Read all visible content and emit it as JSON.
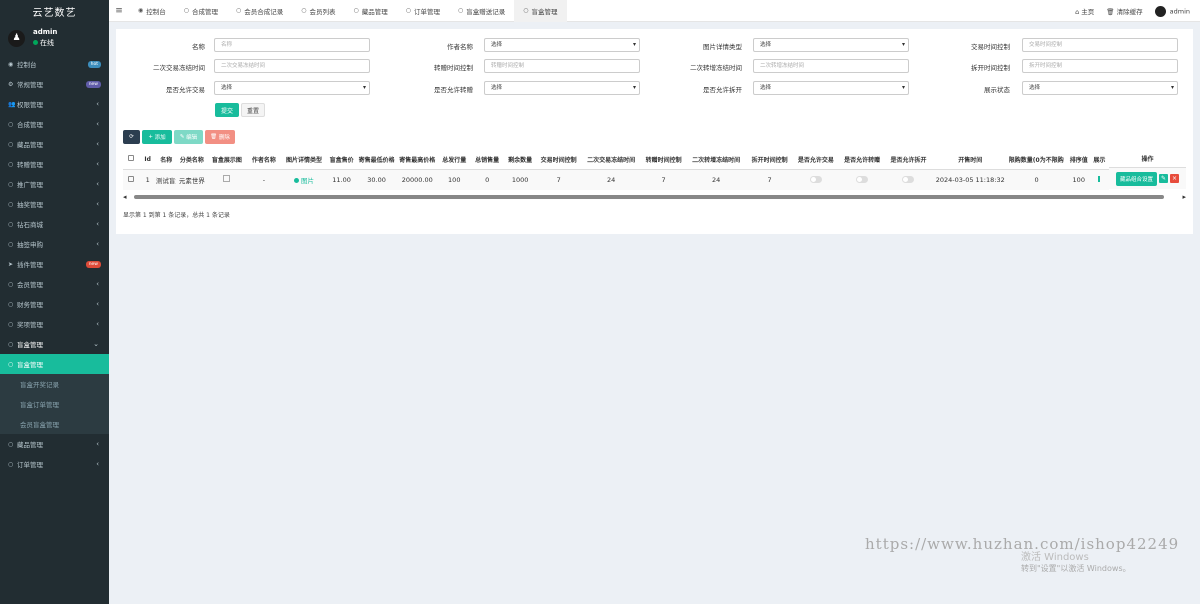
{
  "app": {
    "logo": "云艺数艺",
    "username": "admin",
    "status": "在线"
  },
  "menu": [
    {
      "label": "控制台",
      "icon": "dashboard-icon",
      "badge": "hot",
      "badge_color": "#3c8dbc"
    },
    {
      "label": "常规管理",
      "icon": "gear-icon",
      "badge": "new",
      "badge_color": "#605ca8"
    },
    {
      "label": "权限管理",
      "icon": "users-icon",
      "arrow": "‹"
    },
    {
      "label": "合成管理",
      "icon": "circle-icon",
      "arrow": "‹"
    },
    {
      "label": "藏品管理",
      "icon": "circle-icon",
      "arrow": "‹"
    },
    {
      "label": "转赠管理",
      "icon": "circle-icon",
      "arrow": "‹"
    },
    {
      "label": "推广管理",
      "icon": "circle-icon",
      "arrow": "‹"
    },
    {
      "label": "抽奖管理",
      "icon": "circle-icon",
      "arrow": "‹"
    },
    {
      "label": "钻石商城",
      "icon": "circle-icon",
      "arrow": "‹"
    },
    {
      "label": "抽签申购",
      "icon": "circle-icon",
      "arrow": "‹"
    },
    {
      "label": "插件管理",
      "icon": "rocket-icon",
      "badge": "new",
      "badge_color": "#dd4b39"
    },
    {
      "label": "会员管理",
      "icon": "circle-icon",
      "arrow": "‹"
    },
    {
      "label": "财务管理",
      "icon": "circle-icon",
      "arrow": "‹"
    },
    {
      "label": "奖项管理",
      "icon": "circle-icon",
      "arrow": "‹"
    },
    {
      "label": "盲盒管理",
      "icon": "circle-icon",
      "arrow": "⌄",
      "state": "open"
    },
    {
      "label": "盲盒管理",
      "icon": "circle-icon",
      "state": "active"
    },
    {
      "label": "盲盒开奖记录",
      "state": "sub"
    },
    {
      "label": "盲盒订单管理",
      "state": "sub"
    },
    {
      "label": "会员盲盒管理",
      "state": "sub"
    },
    {
      "label": "藏品管理",
      "icon": "circle-icon",
      "arrow": "‹"
    },
    {
      "label": "订单管理",
      "icon": "circle-icon",
      "arrow": "‹"
    }
  ],
  "tabs": [
    {
      "label": "控制台",
      "icon": "dashboard-icon"
    },
    {
      "label": "合成管理",
      "icon": "circle-icon"
    },
    {
      "label": "会员合成记录",
      "icon": "circle-icon"
    },
    {
      "label": "会员列表",
      "icon": "circle-icon"
    },
    {
      "label": "藏品管理",
      "icon": "circle-icon"
    },
    {
      "label": "订单管理",
      "icon": "circle-icon"
    },
    {
      "label": "盲盒赠送记录",
      "icon": "circle-icon"
    },
    {
      "label": "盲盒管理",
      "icon": "circle-icon",
      "current": true
    }
  ],
  "topright": {
    "home": "主页",
    "clear_cache": "清除缓存",
    "user": "admin"
  },
  "filters": [
    {
      "label": "名称",
      "value": "名称",
      "type": "text"
    },
    {
      "label": "作者名称",
      "value": "选择",
      "type": "select"
    },
    {
      "label": "图片详情类型",
      "value": "选择",
      "type": "select"
    },
    {
      "label": "交易时间控制",
      "value": "交易时间控制",
      "type": "text"
    },
    {
      "label": "二次交易冻结时间",
      "value": "二次交易冻结时间",
      "type": "text"
    },
    {
      "label": "转赠时间控制",
      "value": "转赠时间控制",
      "type": "text"
    },
    {
      "label": "二次转增冻结时间",
      "value": "二次转增冻结时间",
      "type": "text"
    },
    {
      "label": "拆开时间控制",
      "value": "拆开时间控制",
      "type": "text"
    },
    {
      "label": "是否允许交易",
      "value": "选择",
      "type": "select"
    },
    {
      "label": "是否允许转赠",
      "value": "选择",
      "type": "select"
    },
    {
      "label": "是否允许拆开",
      "value": "选择",
      "type": "select"
    },
    {
      "label": "展示状态",
      "value": "选择",
      "type": "select"
    }
  ],
  "form_buttons": {
    "submit": "提交",
    "reset": "重置"
  },
  "toolbar": {
    "add": "添加",
    "edit": "编辑",
    "delete": "删除"
  },
  "table": {
    "headers": [
      "Id",
      "名称",
      "分类名称",
      "盲盒展示图",
      "作者名称",
      "图片详情类型",
      "盲盒售价",
      "寄售最低价格",
      "寄售最高价格",
      "总发行量",
      "总销售量",
      "剩余数量",
      "交易时间控制",
      "二次交易冻结时间",
      "转赠时间控制",
      "二次转增冻结时间",
      "拆开时间控制",
      "是否允许交易",
      "是否允许转赠",
      "是否允许拆开",
      "开售时间",
      "限购数量(0为不限购)",
      "排序值",
      "展示",
      "操作"
    ],
    "rows": [
      {
        "id": "1",
        "name": "测试盲盒",
        "category": "元素世界",
        "author": "-",
        "img_type": "图片",
        "price": "11.00",
        "min_price": "30.00",
        "max_price": "20000.00",
        "total": "100",
        "sold": "0",
        "remain": "1000",
        "trade_time": "7",
        "trade_freeze": "24",
        "gift_time": "7",
        "gift_freeze": "24",
        "open_time": "7",
        "sale_time": "2024-03-05 11:18:32",
        "limit": "0",
        "sort": "100",
        "op_label": "藏品组合设置"
      }
    ]
  },
  "pagination_text": "显示第 1 到第 1 条记录，总共 1 条记录",
  "watermark": {
    "url": "https://www.huzhan.com/ishop42249",
    "line1": "激活 Windows",
    "line2": "转到\"设置\"以激活 Windows。"
  }
}
